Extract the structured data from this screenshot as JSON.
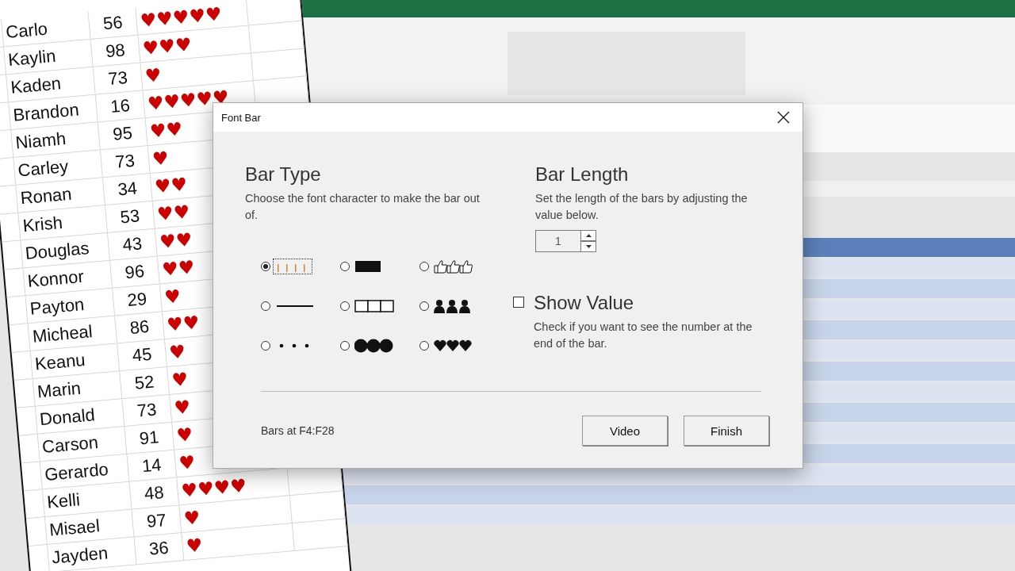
{
  "sheet": {
    "rows": [
      {
        "name": "Carlo",
        "value": "56",
        "bar": "♥♥♥♥♥"
      },
      {
        "name": "Kaylin",
        "value": "98",
        "bar": "♥♥♥"
      },
      {
        "name": "Kaden",
        "value": "73",
        "bar": "♥"
      },
      {
        "name": "Brandon",
        "value": "16",
        "bar": "♥♥♥♥♥"
      },
      {
        "name": "Niamh",
        "value": "95",
        "bar": "♥♥"
      },
      {
        "name": "Carley",
        "value": "73",
        "bar": "♥"
      },
      {
        "name": "Ronan",
        "value": "34",
        "bar": "♥♥"
      },
      {
        "name": "Krish",
        "value": "53",
        "bar": "♥♥"
      },
      {
        "name": "Douglas",
        "value": "43",
        "bar": "♥♥"
      },
      {
        "name": "Konnor",
        "value": "96",
        "bar": "♥♥"
      },
      {
        "name": "Payton",
        "value": "29",
        "bar": "♥"
      },
      {
        "name": "Micheal",
        "value": "86",
        "bar": "♥♥"
      },
      {
        "name": "Keanu",
        "value": "45",
        "bar": "♥"
      },
      {
        "name": "Marin",
        "value": "52",
        "bar": "♥"
      },
      {
        "name": "Donald",
        "value": "73",
        "bar": "♥"
      },
      {
        "name": "Carson",
        "value": "91",
        "bar": "♥"
      },
      {
        "name": "Gerardo",
        "value": "14",
        "bar": "♥"
      },
      {
        "name": "Kelli",
        "value": "48",
        "bar": "♥♥♥♥"
      },
      {
        "name": "Misael",
        "value": "97",
        "bar": "♥"
      },
      {
        "name": "Jayden",
        "value": "36",
        "bar": "♥"
      }
    ]
  },
  "dialog": {
    "title": "Font Bar",
    "bar_type": {
      "heading": "Bar Type",
      "description": "Choose the font character to make the bar out of.",
      "options": [
        {
          "kind": "ticks",
          "selected": true
        },
        {
          "kind": "block",
          "selected": false
        },
        {
          "kind": "thumbs",
          "selected": false
        },
        {
          "kind": "line",
          "selected": false
        },
        {
          "kind": "boxes",
          "selected": false
        },
        {
          "kind": "people",
          "selected": false
        },
        {
          "kind": "dots",
          "selected": false
        },
        {
          "kind": "circles",
          "selected": false
        },
        {
          "kind": "hearts",
          "selected": false
        }
      ]
    },
    "bar_length": {
      "heading": "Bar Length",
      "description": "Set the length of the bars by adjusting the value below.",
      "value": "1"
    },
    "show_value": {
      "label": "Show Value",
      "checked": false,
      "description": "Check if you want to see the number at the end of the bar."
    },
    "status": "Bars at F4:F28",
    "buttons": [
      "Video",
      "Finish"
    ]
  }
}
